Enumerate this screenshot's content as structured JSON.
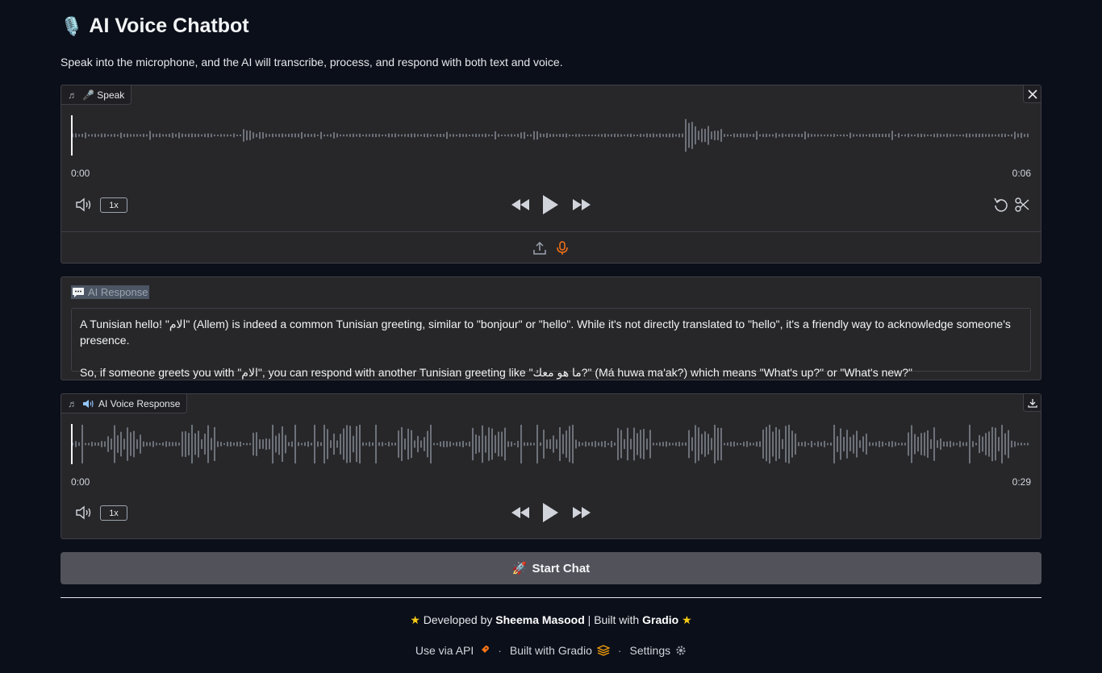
{
  "app": {
    "title_emoji": "🎙️",
    "title": "AI Voice Chatbot",
    "subtitle": "Speak into the microphone, and the AI will transcribe, process, and respond with both text and voice."
  },
  "input_audio": {
    "label": "🎤 Speak",
    "time_current": "0:00",
    "time_total": "0:06",
    "playback_rate": "1x"
  },
  "text_response": {
    "label": "AI Response",
    "text": "A Tunisian hello! \"الام\" (Allem) is indeed a common Tunisian greeting, similar to \"bonjour\" or \"hello\". While it's not directly translated to \"hello\", it's a friendly way to acknowledge someone's presence.\n\nSo, if someone greets you with \"الام\", you can respond with another Tunisian greeting like \"ما هو معك?\" (Má huwa ma'ak?) which means \"What's up?\" or \"What's new?\""
  },
  "output_audio": {
    "label": "AI Voice Response",
    "time_current": "0:00",
    "time_total": "0:29",
    "playback_rate": "1x"
  },
  "start_button": {
    "emoji": "🚀",
    "label": "Start Chat"
  },
  "credit": {
    "prefix": "Developed by",
    "author": "Sheema Masood",
    "separator": "|",
    "middle": "Built with",
    "framework": "Gradio",
    "star": "★"
  },
  "footer": {
    "api_label": "Use via API",
    "built_label": "Built with Gradio",
    "settings_label": "Settings",
    "dot": "·"
  },
  "colors": {
    "background": "#0b0f19",
    "panel": "#27272a",
    "accent_orange": "#f97316",
    "button": "#52525b"
  }
}
